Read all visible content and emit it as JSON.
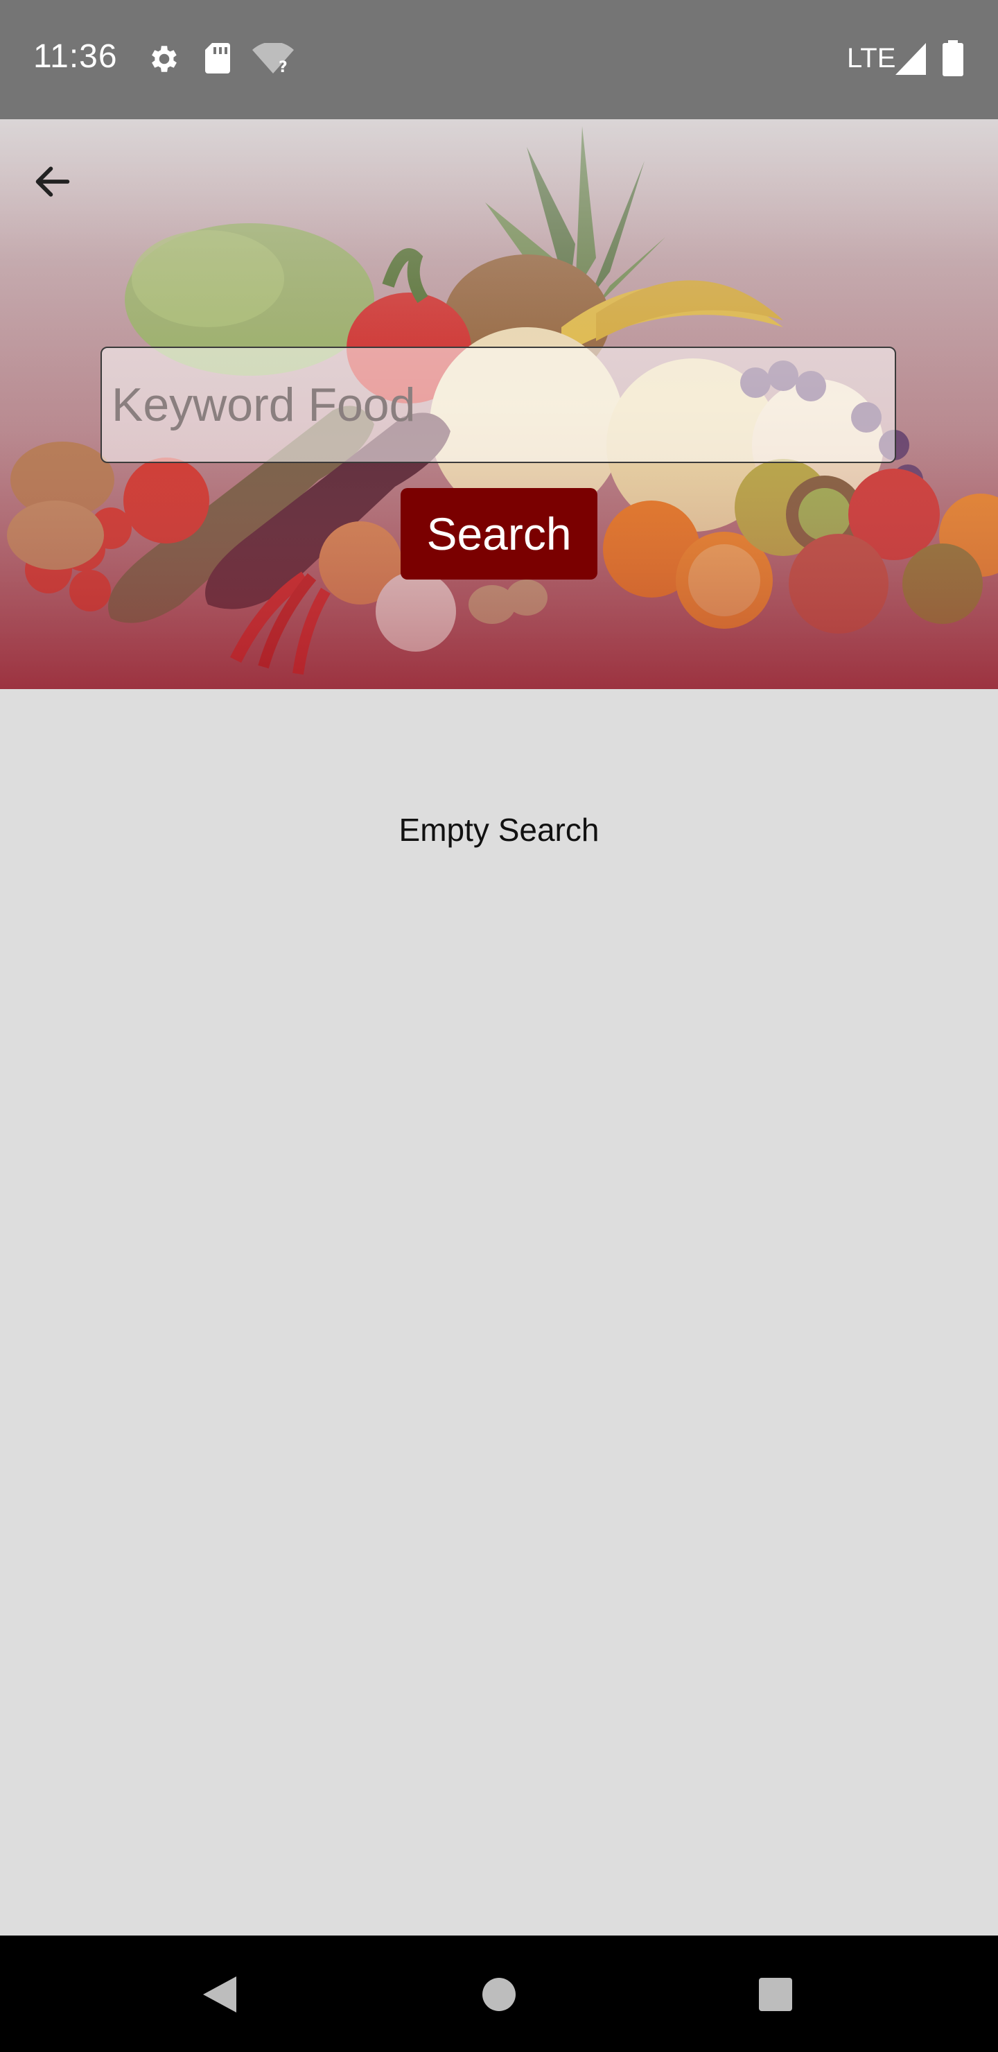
{
  "status_bar": {
    "time": "11:36",
    "network_label": "LTE",
    "icons": [
      "gear-icon",
      "sd-card-icon",
      "wifi-question-icon",
      "signal-icon",
      "battery-icon"
    ]
  },
  "header": {
    "back_icon": "arrow-left-icon",
    "search": {
      "placeholder": "Keyword Food",
      "value": ""
    },
    "search_button_label": "Search",
    "accent_color": "#7a0000"
  },
  "main": {
    "empty_message": "Empty Search"
  },
  "nav_bar": {
    "icons": [
      "back-triangle-icon",
      "home-circle-icon",
      "recents-square-icon"
    ]
  }
}
